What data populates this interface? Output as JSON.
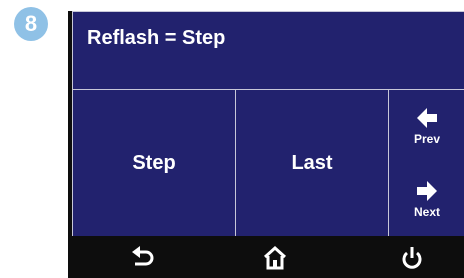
{
  "step_badge": "8",
  "screen": {
    "title": "Reflash = Step",
    "buttons": {
      "step": "Step",
      "last": "Last",
      "prev": "Prev",
      "next": "Next"
    }
  },
  "icons": {
    "prev": "arrow-left-icon",
    "next": "arrow-right-icon",
    "back": "back-icon",
    "home": "home-icon",
    "power": "power-icon"
  },
  "colors": {
    "screen_bg": "#22226e",
    "badge": "#8fc1e6",
    "text": "#ffffff",
    "bezel": "#0d0d0d"
  }
}
